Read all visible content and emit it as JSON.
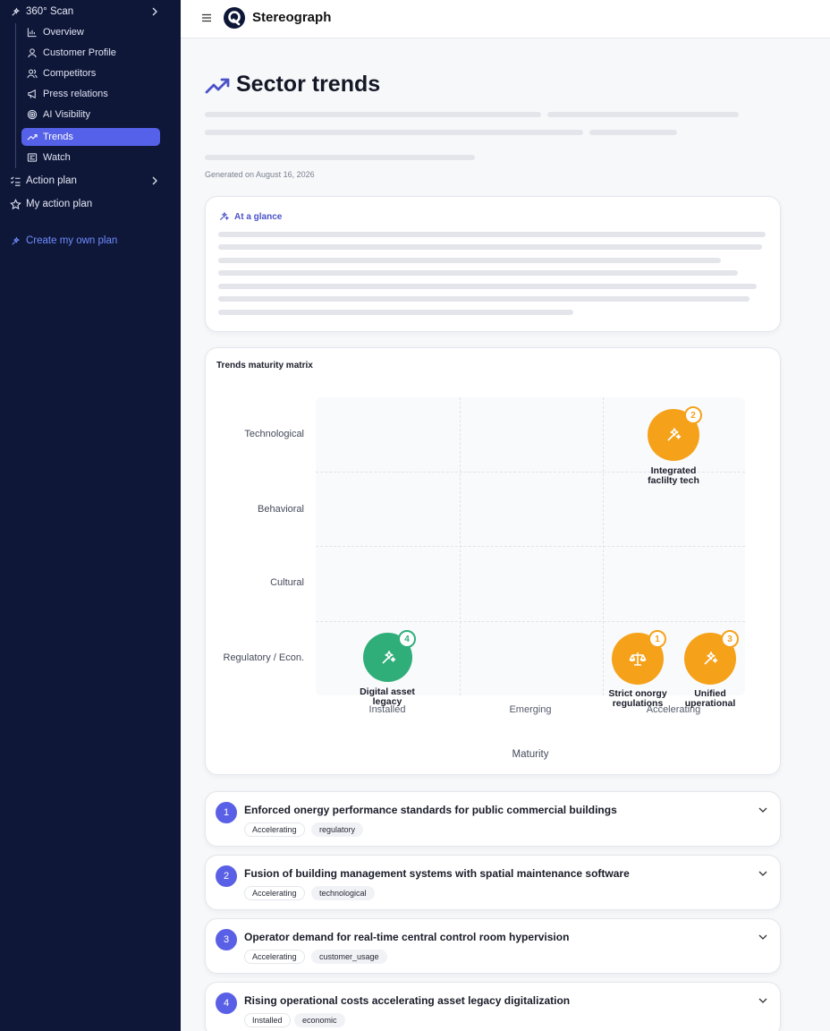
{
  "sidebar": {
    "scan_label": "360° Scan",
    "sub_items": [
      {
        "label": "Overview",
        "icon": "bar-chart-icon"
      },
      {
        "label": "Customer Profile",
        "icon": "user-icon"
      },
      {
        "label": "Competitors",
        "icon": "users-icon"
      },
      {
        "label": "Press relations",
        "icon": "megaphone-icon"
      },
      {
        "label": "AI Visibility",
        "icon": "target-icon"
      },
      {
        "label": "Trends",
        "icon": "trend-icon",
        "active": true
      },
      {
        "label": "Watch",
        "icon": "newspaper-icon"
      }
    ],
    "action_plan": "Action plan",
    "my_action_plan": "My action plan",
    "create_plan": "Create my own plan"
  },
  "topbar": {
    "brand": "Stereograph"
  },
  "page": {
    "title": "Sector trends",
    "generated": "Generated on August 16, 2026"
  },
  "glance": {
    "title": "At a glance"
  },
  "matrix": {
    "title": "Trends maturity matrix",
    "y_categories": [
      "Technological",
      "Behavioral",
      "Cultural",
      "Regulatory / Econ."
    ],
    "x_categories": [
      "Installed",
      "Emerging",
      "Accelerating"
    ],
    "x_title": "Maturity",
    "points": [
      {
        "id": "1",
        "label_line1": "Strict onorgy",
        "label_line2": "regulations",
        "x": "Accelerating",
        "y": "Regulatory / Econ.",
        "color": "#f5a21a"
      },
      {
        "id": "2",
        "label_line1": "Integrated",
        "label_line2": "faclilty tech",
        "x": "Accelerating",
        "y": "Technological",
        "color": "#f5a21a"
      },
      {
        "id": "3",
        "label_line1": "Unified",
        "label_line2": "uperational",
        "x": "Accelerating",
        "y": "Regulatory / Econ.",
        "color": "#f5a21a"
      },
      {
        "id": "4",
        "label_line1": "Digital asset",
        "label_line2": "legacy",
        "x": "Installed",
        "y": "Regulatory / Econ.",
        "color": "#2fae7a"
      }
    ]
  },
  "trends": [
    {
      "num": "1",
      "title": "Enforced onergy performance standards for public commercial buildings",
      "status": "Accelerating",
      "category": "regulatory"
    },
    {
      "num": "2",
      "title": "Fusion of building management systems with spatial maintenance software",
      "status": "Accelerating",
      "category": "technological"
    },
    {
      "num": "3",
      "title": "Operator demand for real-time central control room hypervision",
      "status": "Accelerating",
      "category": "customer_usage"
    },
    {
      "num": "4",
      "title": "Rising operational costs accelerating asset legacy digitalization",
      "status": "Installed",
      "category": "economic"
    }
  ],
  "colors": {
    "sidebar_bg": "#0e1738",
    "accent": "#5561e8",
    "orange": "#f5a21a",
    "green": "#2fae7a"
  }
}
